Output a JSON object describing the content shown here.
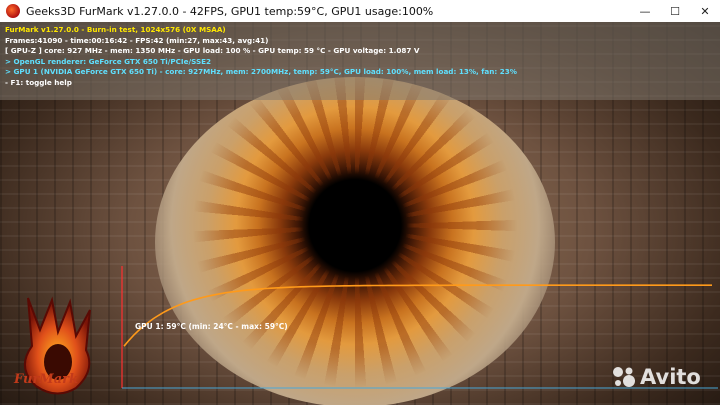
{
  "window": {
    "title": "Geeks3D FurMark v1.27.0.0 - 42FPS, GPU1 temp:59°C, GPU1 usage:100%",
    "minimize_glyph": "—",
    "maximize_glyph": "☐",
    "close_glyph": "✕"
  },
  "overlay": {
    "line1": "FurMark v1.27.0.0 - Burn-in test, 1024x576 (0X MSAA)",
    "line2": "Frames:41090 - time:00:16:42 - FPS:42 (min:27, max:43, avg:41)",
    "line3": "[ GPU-Z ] core: 927 MHz - mem: 1350 MHz - GPU load: 100 % - GPU temp: 59 °C - GPU voltage: 1.087 V",
    "line4": "> OpenGL renderer: GeForce GTX 650 Ti/PCIe/SSE2",
    "line5": "> GPU 1 (NVIDIA GeForce GTX 650 Ti) - core: 927MHz, mem: 2700MHz, temp: 59°C, GPU load: 100%, mem load: 13%, fan: 23%",
    "line6": "- F1: toggle help"
  },
  "graph": {
    "label": "GPU 1: 59°C (min: 24°C - max: 59°C)",
    "min_temp": 24,
    "max_temp": 59,
    "current_temp": 59
  },
  "logo": {
    "text": "FurMark"
  },
  "watermark": {
    "text": "Avito",
    "icon": "avito-dots-icon"
  },
  "colors": {
    "overlay_title": "#ffe800",
    "overlay_info": "#ffffff",
    "overlay_gpu": "#5fe0ff",
    "temp_curve": "#ff9a1a",
    "graph_axis": "#ff3030"
  }
}
